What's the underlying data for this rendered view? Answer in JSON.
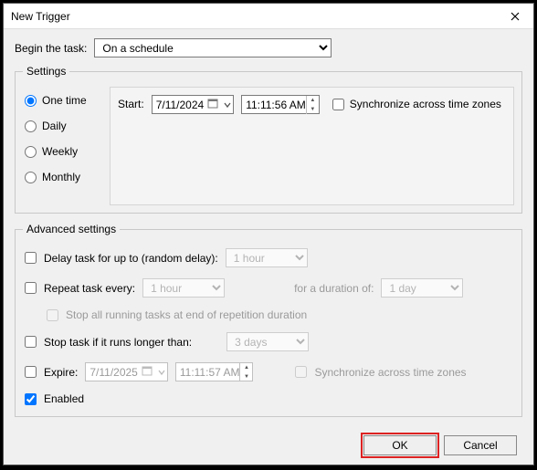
{
  "window": {
    "title": "New Trigger"
  },
  "begin": {
    "label": "Begin the task:",
    "value": "On a schedule"
  },
  "settings": {
    "legend": "Settings",
    "radios": {
      "one_time": "One time",
      "daily": "Daily",
      "weekly": "Weekly",
      "monthly": "Monthly"
    },
    "start_label": "Start:",
    "start_date": "7/11/2024",
    "start_time": "11:11:56 AM",
    "sync_label": "Synchronize across time zones"
  },
  "advanced": {
    "legend": "Advanced settings",
    "delay_label": "Delay task for up to (random delay):",
    "delay_value": "1 hour",
    "repeat_label": "Repeat task every:",
    "repeat_value": "1 hour",
    "duration_label": "for a duration of:",
    "duration_value": "1 day",
    "stop_running_label": "Stop all running tasks at end of repetition duration",
    "stop_if_longer_label": "Stop task if it runs longer than:",
    "stop_if_longer_value": "3 days",
    "expire_label": "Expire:",
    "expire_date": "7/11/2025",
    "expire_time": "11:11:57 AM",
    "sync2_label": "Synchronize across time zones",
    "enabled_label": "Enabled"
  },
  "buttons": {
    "ok": "OK",
    "cancel": "Cancel"
  }
}
